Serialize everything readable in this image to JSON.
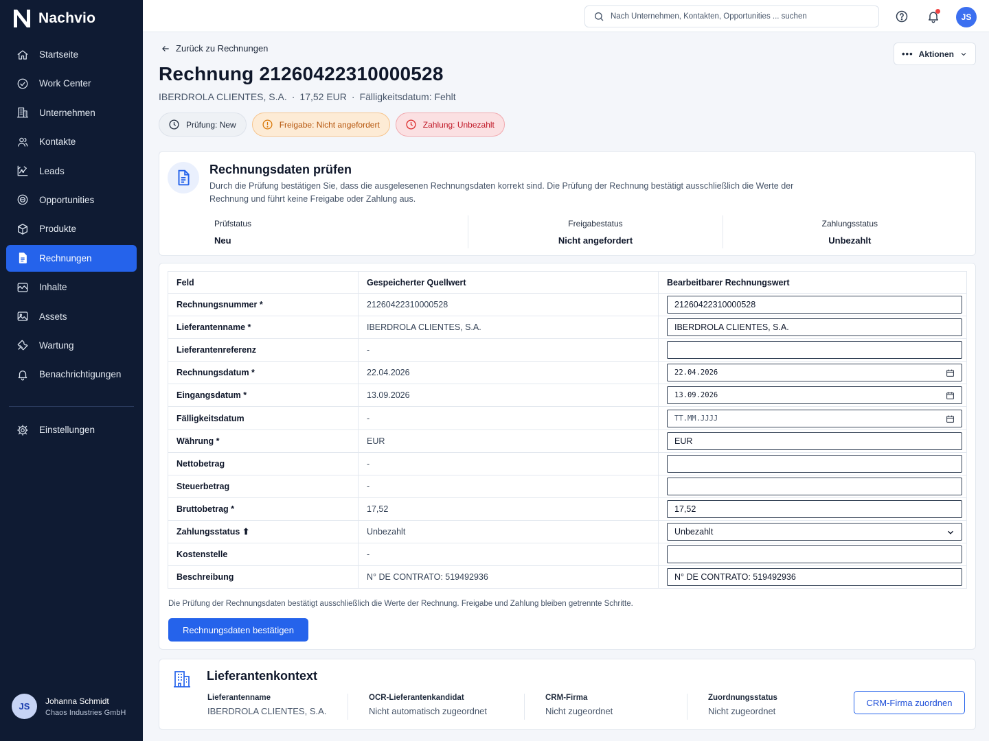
{
  "app": {
    "name": "Nachvio"
  },
  "sidebar": {
    "items": [
      {
        "label": "Startseite",
        "icon": "home-icon"
      },
      {
        "label": "Work Center",
        "icon": "check-circle-icon"
      },
      {
        "label": "Unternehmen",
        "icon": "building-icon"
      },
      {
        "label": "Kontakte",
        "icon": "users-icon"
      },
      {
        "label": "Leads",
        "icon": "leads-icon"
      },
      {
        "label": "Opportunities",
        "icon": "target-icon"
      },
      {
        "label": "Produkte",
        "icon": "box-icon"
      },
      {
        "label": "Rechnungen",
        "icon": "invoice-icon",
        "active": true
      },
      {
        "label": "Inhalte",
        "icon": "content-icon"
      },
      {
        "label": "Assets",
        "icon": "image-icon"
      },
      {
        "label": "Wartung",
        "icon": "wrench-icon"
      },
      {
        "label": "Benachrichtigungen",
        "icon": "bell-icon"
      }
    ],
    "settings": {
      "label": "Einstellungen",
      "icon": "gear-icon"
    },
    "user": {
      "initials": "JS",
      "name": "Johanna Schmidt",
      "company": "Chaos Industries GmbH"
    }
  },
  "topbar": {
    "search_placeholder": "Nach Unternehmen, Kontakten, Opportunities ... suchen",
    "avatar_initials": "JS",
    "has_notification": true
  },
  "header": {
    "back_label": "Zurück zu Rechnungen",
    "actions_label": "Aktionen",
    "title": "Rechnung 21260422310000528",
    "supplier": "IBERDROLA CLIENTES, S.A.",
    "amount": "17,52 EUR",
    "due": "Fälligkeitsdatum: Fehlt",
    "badges": [
      {
        "label": "Prüfung: New",
        "tone": "neutral"
      },
      {
        "label": "Freigabe: Nicht angefordert",
        "tone": "warn"
      },
      {
        "label": "Zahlung: Unbezahlt",
        "tone": "danger"
      }
    ]
  },
  "review": {
    "title": "Rechnungsdaten prüfen",
    "description": "Durch die Prüfung bestätigen Sie, dass die ausgelesenen Rechnungsdaten korrekt sind. Die Prüfung der Rechnung bestätigt ausschließlich die Werte der Rechnung und führt keine Freigabe oder Zahlung aus.",
    "statuses": [
      {
        "label": "Prüfstatus",
        "value": "Neu"
      },
      {
        "label": "Freigabestatus",
        "value": "Nicht angefordert"
      },
      {
        "label": "Zahlungsstatus",
        "value": "Unbezahlt"
      }
    ]
  },
  "table": {
    "headers": [
      "Feld",
      "Gespeicherter Quellwert",
      "Bearbeitbarer Rechnungswert"
    ],
    "rows": [
      {
        "field": "Rechnungsnummer *",
        "source": "21260422310000528",
        "value": "21260422310000528",
        "type": "text"
      },
      {
        "field": "Lieferantenname *",
        "source": "IBERDROLA CLIENTES, S.A.",
        "value": "IBERDROLA CLIENTES, S.A.",
        "type": "text"
      },
      {
        "field": "Lieferantenreferenz",
        "source": "-",
        "value": "",
        "type": "text"
      },
      {
        "field": "Rechnungsdatum *",
        "source": "22.04.2026",
        "value": "22.04.2026",
        "type": "date"
      },
      {
        "field": "Eingangsdatum *",
        "source": "13.09.2026",
        "value": "13.09.2026",
        "type": "date"
      },
      {
        "field": "Fälligkeitsdatum",
        "source": "-",
        "value": "",
        "placeholder": "TT.MM.JJJJ",
        "type": "date"
      },
      {
        "field": "Währung *",
        "source": "EUR",
        "value": "EUR",
        "type": "text"
      },
      {
        "field": "Nettobetrag",
        "source": "-",
        "value": "",
        "type": "text"
      },
      {
        "field": "Steuerbetrag",
        "source": "-",
        "value": "",
        "type": "text"
      },
      {
        "field": "Bruttobetrag *",
        "source": "17,52",
        "value": "17,52",
        "type": "text"
      },
      {
        "field": "Zahlungsstatus ⬆",
        "source": "Unbezahlt",
        "value": "Unbezahlt",
        "type": "select"
      },
      {
        "field": "Kostenstelle",
        "source": "-",
        "value": "",
        "type": "text"
      },
      {
        "field": "Beschreibung",
        "source": "N° DE CONTRATO: 519492936",
        "value": "N° DE CONTRATO: 519492936",
        "type": "text"
      }
    ],
    "note": "Die Prüfung der Rechnungsdaten bestätigt ausschließlich die Werte der Rechnung. Freigabe und Zahlung bleiben getrennte Schritte.",
    "confirm_label": "Rechnungsdaten bestätigen"
  },
  "supplier": {
    "title": "Lieferantenkontext",
    "columns": [
      {
        "label": "Lieferantenname",
        "value": "IBERDROLA CLIENTES, S.A."
      },
      {
        "label": "OCR-Lieferantenkandidat",
        "value": "Nicht automatisch zugeordnet"
      },
      {
        "label": "CRM-Firma",
        "value": "Nicht zugeordnet"
      },
      {
        "label": "Zuordnungsstatus",
        "value": "Nicht zugeordnet"
      }
    ],
    "assign_label": "CRM-Firma zuordnen"
  },
  "colors": {
    "accent": "#2563eb",
    "sidebar": "#0f1b33",
    "warn": "#d97706",
    "danger": "#dc2626"
  }
}
